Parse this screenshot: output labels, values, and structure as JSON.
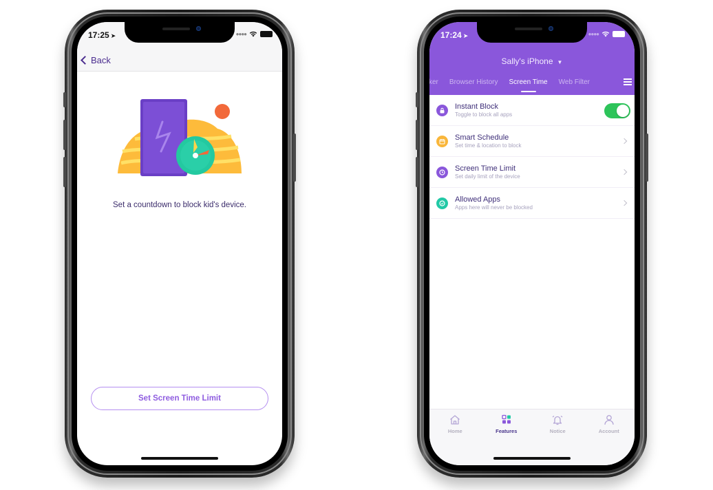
{
  "left_phone": {
    "status": {
      "time": "17:25",
      "location_arrow": "➤"
    },
    "nav": {
      "back_label": "Back"
    },
    "illustration": "phone-with-timer-illustration",
    "subtitle": "Set a countdown to block kid's device.",
    "button_label": "Set Screen Time Limit",
    "colors": {
      "accent": "#8f5de0",
      "text": "#3b2c6b"
    }
  },
  "right_phone": {
    "status": {
      "time": "17:24",
      "location_arrow": "➤"
    },
    "device_title": "Sally's iPhone",
    "device_caret": "▼",
    "tabs": [
      {
        "label": "cker",
        "active": false
      },
      {
        "label": "Browser History",
        "active": false
      },
      {
        "label": "Screen Time",
        "active": true
      },
      {
        "label": "Web Filter",
        "active": false
      }
    ],
    "items": [
      {
        "title": "Instant Block",
        "subtitle": "Toggle to block all apps",
        "icon": "lock-icon",
        "icon_color": "#8a57db",
        "control": "toggle",
        "toggle_on": true
      },
      {
        "title": "Smart Schedule",
        "subtitle": "Set time & location to block",
        "icon": "calendar-icon",
        "icon_color": "#f9b63a",
        "control": "chevron"
      },
      {
        "title": "Screen Time Limit",
        "subtitle": "Set daily limit of the device",
        "icon": "clock-icon",
        "icon_color": "#8a57db",
        "control": "chevron"
      },
      {
        "title": "Allowed Apps",
        "subtitle": "Apps here will never be blocked",
        "icon": "check-icon",
        "icon_color": "#22c9a6",
        "control": "chevron"
      }
    ],
    "tabbar": [
      {
        "label": "Home",
        "icon": "home-icon",
        "active": false
      },
      {
        "label": "Features",
        "icon": "features-icon",
        "active": true
      },
      {
        "label": "Notice",
        "icon": "bell-icon",
        "active": false
      },
      {
        "label": "Account",
        "icon": "account-icon",
        "active": false
      }
    ],
    "colors": {
      "header": "#8a57db",
      "toggle": "#2dc45a",
      "title_text": "#3f2f79"
    }
  }
}
